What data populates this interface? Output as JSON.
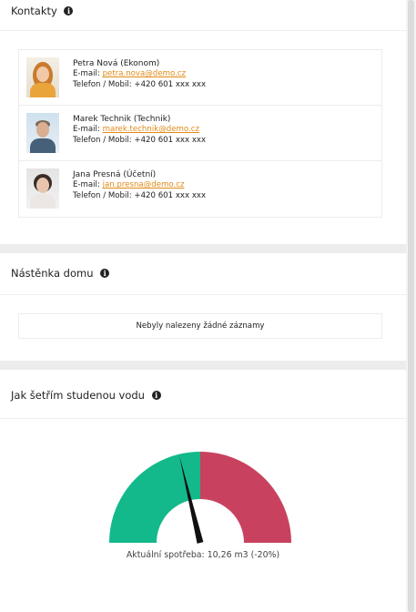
{
  "contacts": {
    "title": "Kontakty",
    "items": [
      {
        "name": "Petra Nová (Ekonom)",
        "email_label": "E-mail:",
        "email": "petra.nova@demo.cz",
        "phone": "Telefon / Mobil: +420 601 xxx xxx"
      },
      {
        "name": "Marek Technik (Technik)",
        "email_label": "E-mail:",
        "email": "marek.technik@demo.cz",
        "phone": "Telefon / Mobil: +420 601 xxx xxx"
      },
      {
        "name": "Jana Presná (Účetní)",
        "email_label": "E-mail:",
        "email": "jan.presna@demo.cz",
        "phone": "Telefon / Mobil: +420 601 xxx xxx"
      }
    ]
  },
  "board": {
    "title": "Nástěnka domu",
    "empty_text": "Nebyly nalezeny žádné záznamy"
  },
  "water": {
    "title": "Jak šetřím studenou vodu",
    "label": "Aktuální spotřeba: 10,26 m3 (-20%)",
    "gauge": {
      "good_color": "#13b98a",
      "bad_color": "#c8425f",
      "needle_value": -0.2
    }
  },
  "icons": {
    "info": "i"
  }
}
